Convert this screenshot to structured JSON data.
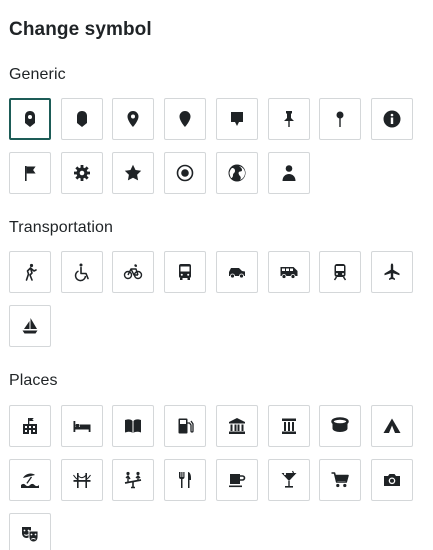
{
  "title": "Change symbol",
  "selected": "generic-0",
  "sections": [
    {
      "key": "generic",
      "label": "Generic",
      "icons": [
        "marker",
        "pin-blank",
        "location",
        "pin-drop",
        "speech-marker",
        "push-pin",
        "pin-needle",
        "info",
        "flag",
        "gear",
        "star",
        "target",
        "globe",
        "person"
      ]
    },
    {
      "key": "transportation",
      "label": "Transportation",
      "icons": [
        "walk",
        "wheelchair",
        "bike",
        "bus",
        "car",
        "van",
        "train",
        "airplane",
        "sailboat"
      ]
    },
    {
      "key": "places",
      "label": "Places",
      "icons": [
        "hotel",
        "bed",
        "book",
        "gas-pump",
        "bank",
        "museum",
        "stadium",
        "tent",
        "beach",
        "bridge",
        "playground",
        "restaurant",
        "coffee",
        "cocktail",
        "cart",
        "camera",
        "theater"
      ]
    }
  ]
}
